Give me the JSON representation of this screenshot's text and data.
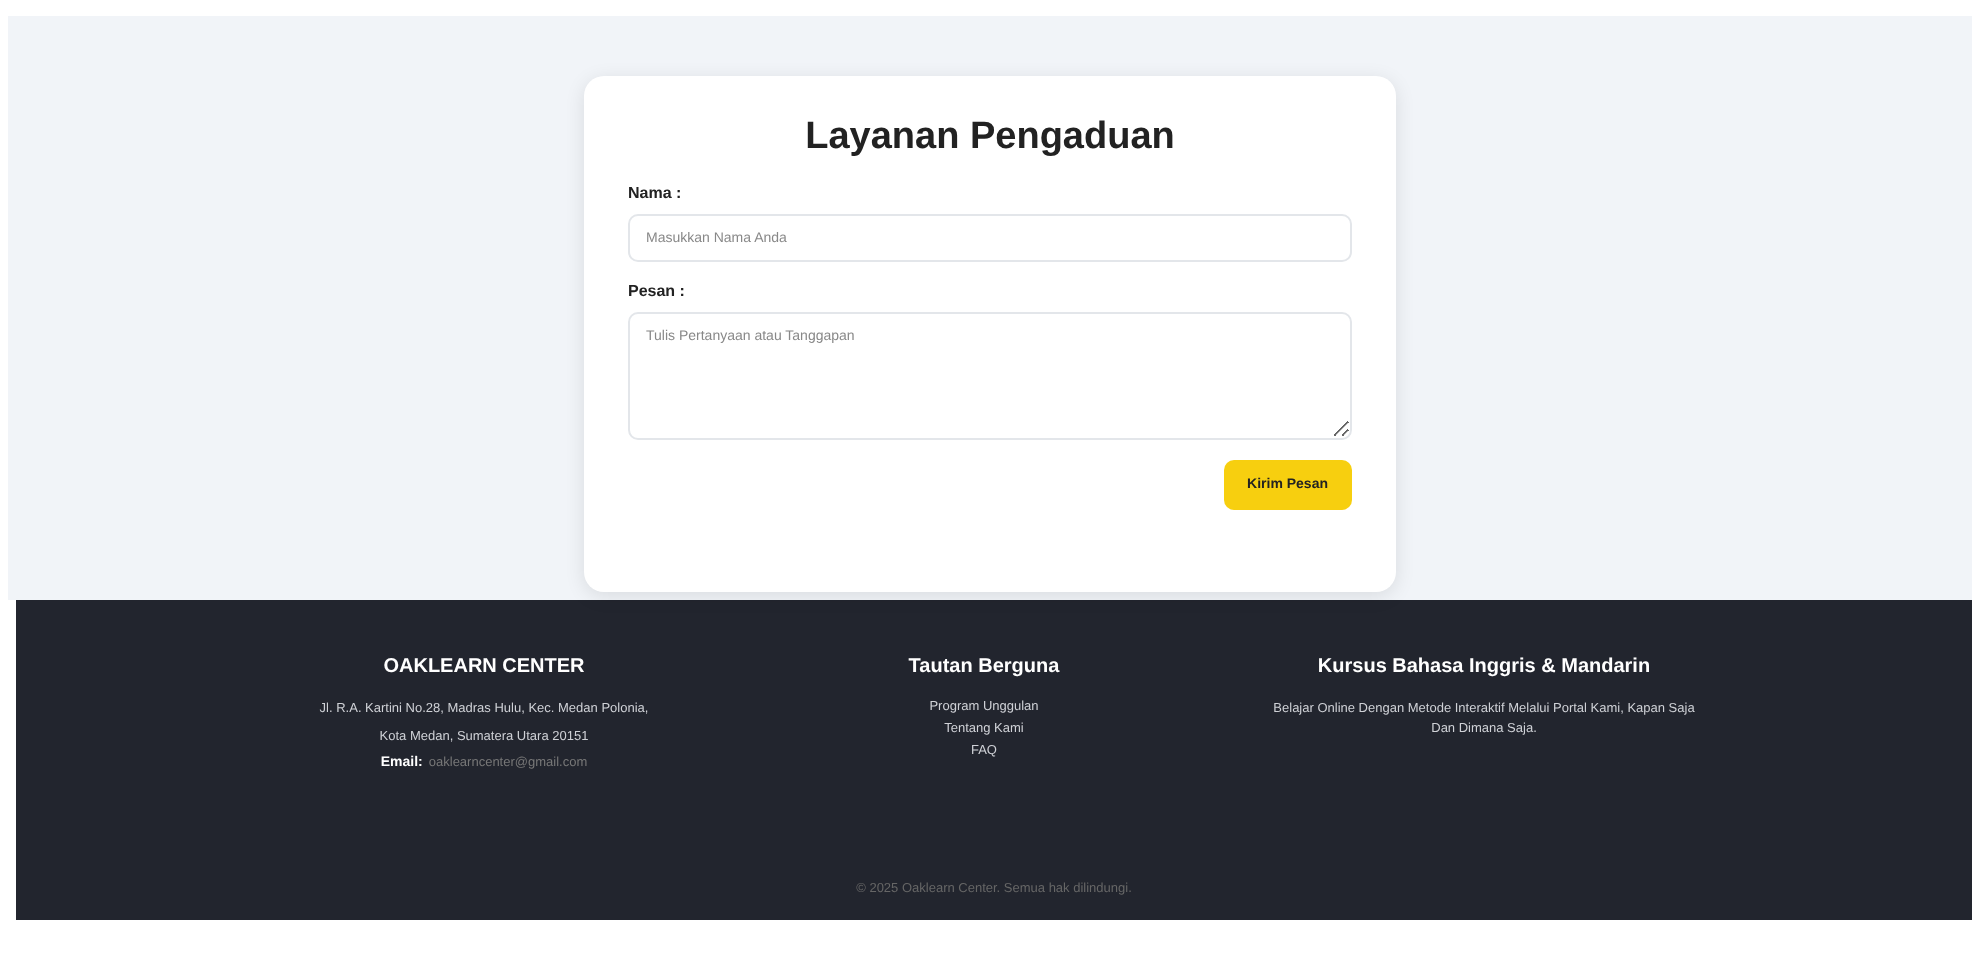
{
  "form": {
    "title": "Layanan Pengaduan",
    "fields": [
      {
        "kind": "input",
        "label": "Nama :",
        "placeholder": "Masukkan Nama Anda"
      },
      {
        "kind": "textarea",
        "label": "Pesan :",
        "placeholder": "Tulis Pertanyaan atau Tanggapan"
      }
    ],
    "submit": "Kirim Pesan"
  },
  "footer": {
    "columns": [
      {
        "title": "OAKLEARN CENTER",
        "lines": [
          {
            "kind": "text",
            "text": "Jl. R.A. Kartini No.28, Madras Hulu, Kec. Medan Polonia,"
          },
          {
            "kind": "text",
            "text": "Kota Medan, Sumatera Utara 20151"
          },
          {
            "kind": "email",
            "label": "Email:",
            "text": "oaklearncenter@gmail.com"
          }
        ]
      },
      {
        "title": "Tautan Berguna",
        "lines": [
          {
            "kind": "link",
            "text": "Program Unggulan"
          },
          {
            "kind": "link",
            "text": "Tentang Kami"
          },
          {
            "kind": "link",
            "text": "FAQ"
          }
        ]
      },
      {
        "title": "Kursus Bahasa Inggris & Mandarin",
        "lines": [
          {
            "kind": "text",
            "text": "Belajar Online Dengan Metode Interaktif Melalui Portal Kami, Kapan Saja Dan Dimana Saja."
          }
        ]
      }
    ],
    "copyright": "© 2025 Oaklearn Center. Semua hak dilindungi."
  }
}
